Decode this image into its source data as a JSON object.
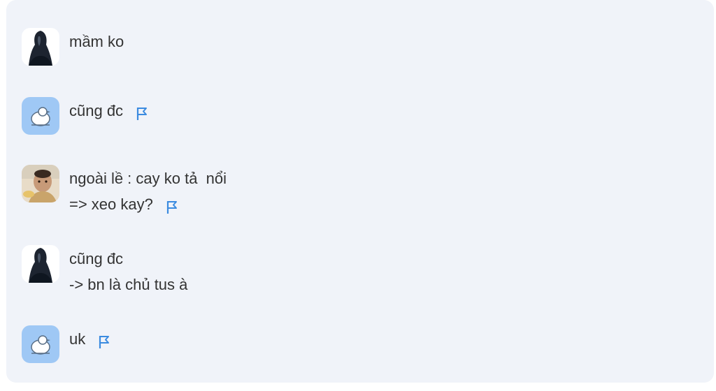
{
  "messages": [
    {
      "avatar": "dark-hair-avatar",
      "lines": [
        "mầm ko"
      ],
      "flag": false
    },
    {
      "avatar": "blue-bird-avatar",
      "lines": [
        "cũng đc"
      ],
      "flag": true,
      "flag_icon": "flag-icon"
    },
    {
      "avatar": "baby-photo-avatar",
      "lines": [
        "ngoài lề : cay ko tả  nổi",
        "=> xeo kay?"
      ],
      "flag": true,
      "flag_icon": "flag-icon"
    },
    {
      "avatar": "dark-hair-avatar",
      "lines": [
        "cũng đc",
        "-> bn là chủ tus à"
      ],
      "flag": false
    },
    {
      "avatar": "blue-bird-avatar",
      "lines": [
        "uk"
      ],
      "flag": true,
      "flag_icon": "flag-icon"
    }
  ],
  "colors": {
    "panel_bg": "#f0f3f9",
    "text": "#333333",
    "flag": "#3b8be0",
    "bird_avatar_bg": "#9fc8f5"
  }
}
